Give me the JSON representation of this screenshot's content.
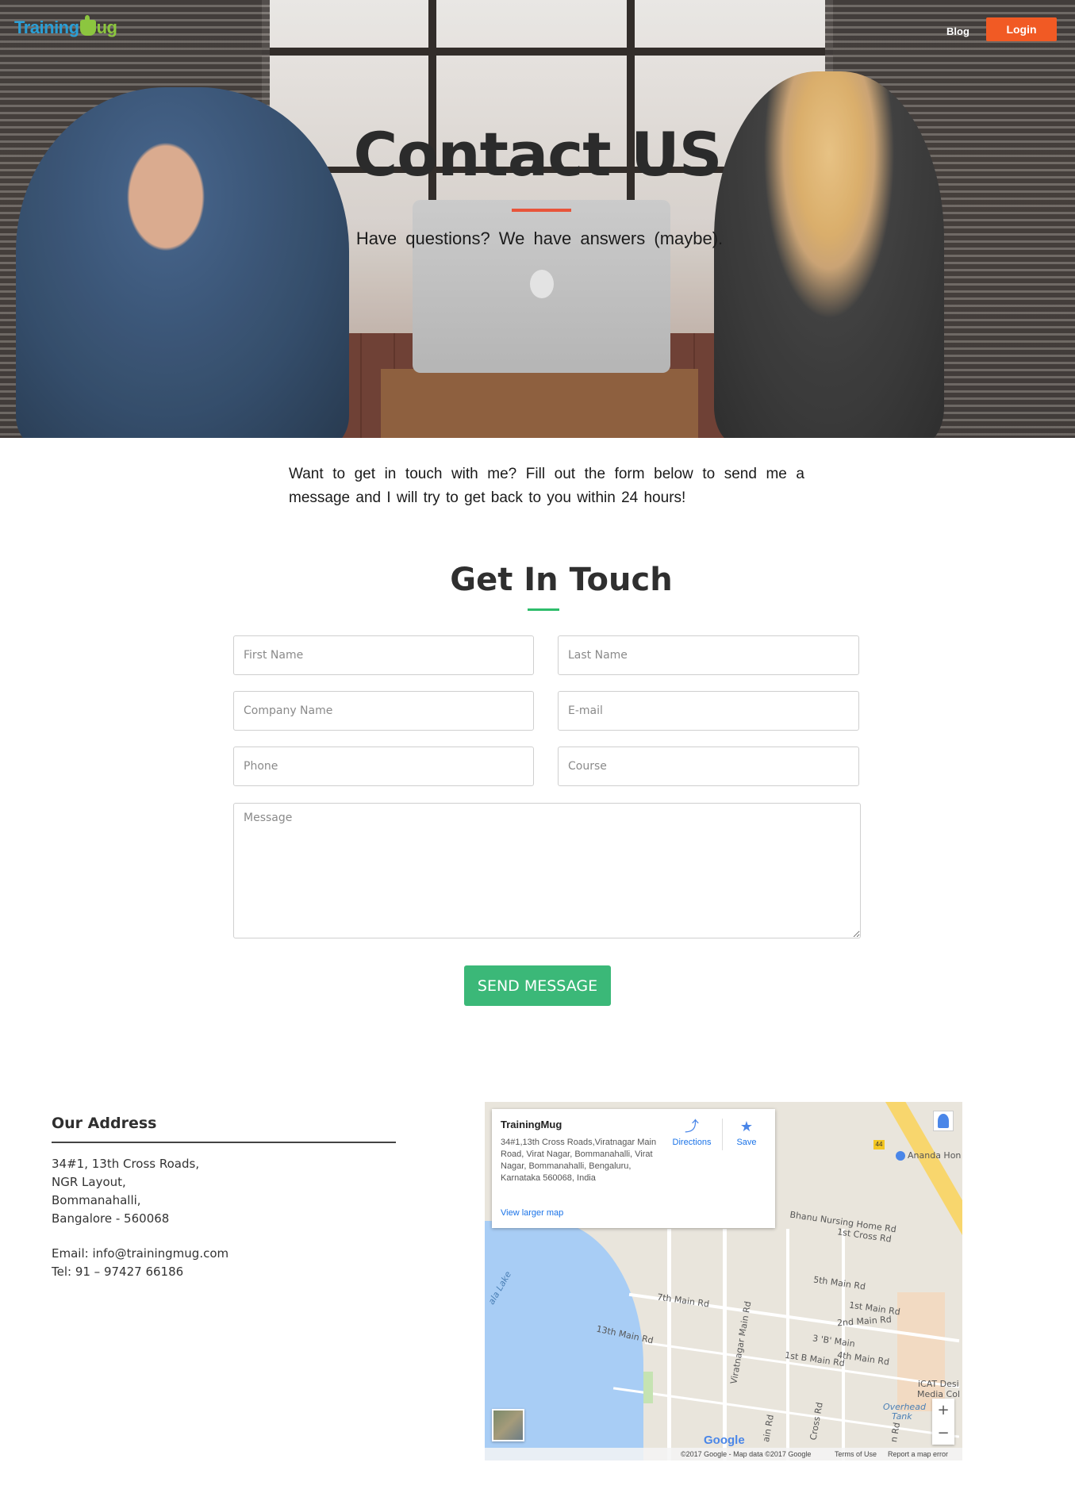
{
  "header": {
    "logo_part1": "Training",
    "logo_part2": "ug",
    "logo_icon": "mug-icon",
    "nav_blog": "Blog",
    "login_label": "Login",
    "accent_color": "#f15a24"
  },
  "hero": {
    "title": "Contact US",
    "subtitle": "Have questions? We have answers (maybe)."
  },
  "intro": {
    "text": "Want to get in touch with me? Fill out the form below to send me a message and I will try to get back to you within 24 hours!"
  },
  "form": {
    "title": "Get In Touch",
    "first_name_placeholder": "First Name",
    "last_name_placeholder": "Last Name",
    "company_placeholder": "Company Name",
    "email_placeholder": "E-mail",
    "phone_placeholder": "Phone",
    "course_placeholder": "Course",
    "message_placeholder": "Message",
    "send_label": "SEND MESSAGE",
    "send_color": "#3bb878"
  },
  "address": {
    "title": "Our Address",
    "lines": [
      "34#1, 13th Cross Roads,",
      "NGR Layout,",
      "Bommanahalli,",
      "Bangalore - 560068"
    ],
    "email_line": "Email: info@trainingmug.com",
    "tel_line": "Tel: 91 – 97427 66186"
  },
  "map": {
    "place_name": "TrainingMug",
    "place_address": "34#1,13th Cross Roads,Viratnagar Main Road, Virat Nagar, Bommanahalli, Virat Nagar, Bommanahalli, Bengaluru, Karnataka 560068, India",
    "view_larger": "View larger map",
    "directions_label": "Directions",
    "save_label": "Save",
    "zoom_in": "+",
    "zoom_out": "−",
    "google_label": "Google",
    "footer_copyright": "©2017 Google - Map data ©2017 Google",
    "footer_terms": "Terms of Use",
    "footer_report": "Report a map error",
    "hwy_number": "44",
    "labels": {
      "ananda": "Ananda Hon",
      "bhanu": "Bhanu Nursing Home Rd",
      "first_cross": "1st Cross Rd",
      "fifth_main": "5th Main Rd",
      "first_main": "1st Main Rd",
      "second_main": "2nd Main Rd",
      "seventh_main": "7th Main Rd",
      "viratnagar": "Viratnagar Main Rd",
      "thirteenth": "13th Main Rd",
      "three_b": "3 'B' Main",
      "fourth_main": "4th Main Rd",
      "first_b": "1st B Main Rd",
      "icat": "iCAT Desi",
      "media": "Media Col",
      "overhead": "Overhead",
      "tank": "Tank",
      "lake": "ala Lake",
      "cross_rd": "Cross Rd",
      "main_rd": "ain Rd",
      "n_rd": "n Rd"
    }
  }
}
